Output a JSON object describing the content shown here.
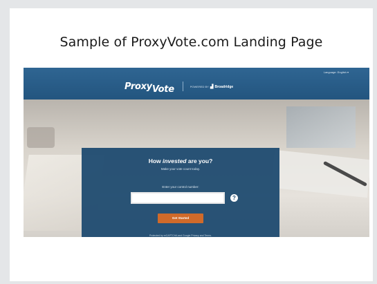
{
  "slide": {
    "title": "Sample of ProxyVote.com Landing Page"
  },
  "site": {
    "language": "Language: English ▾",
    "logo_main": "Proxy",
    "logo_sub": "Vote",
    "powered_by": "POWERED BY",
    "powered_brand": "Broadridge"
  },
  "form": {
    "headline_prefix": "How ",
    "headline_emphasis": "invested",
    "headline_suffix": " are you?",
    "subline": "Make your vote count today.",
    "field_label": "Enter your control number:",
    "control_number_value": "",
    "control_number_placeholder": "",
    "help_icon": "?",
    "button_label": "Get Started",
    "footnote": "Protected by reCAPTCHA and Google Privacy and Terms."
  },
  "colors": {
    "header_blue": "#23557f",
    "panel_blue": "#1f4b70",
    "button_orange": "#d06a2a"
  }
}
